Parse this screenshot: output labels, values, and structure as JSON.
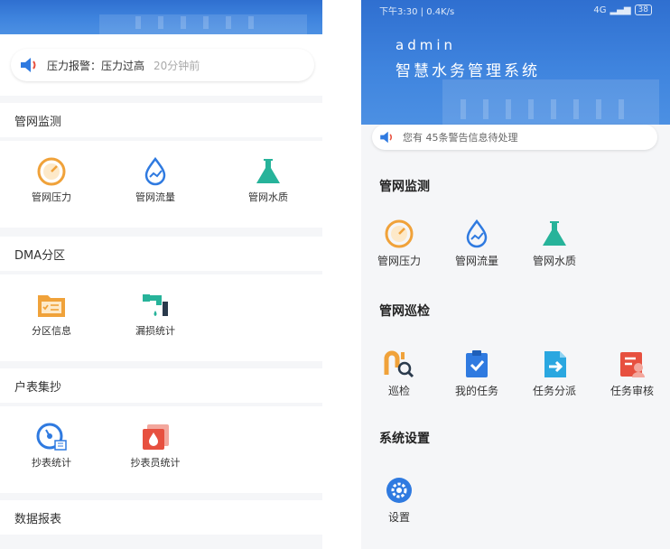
{
  "left": {
    "alert": {
      "text": "压力报警：压力过高",
      "time": "20分钟前"
    },
    "sections": [
      {
        "title": "管网监测",
        "items": [
          {
            "label": "管网压力",
            "icon": "gauge-icon"
          },
          {
            "label": "管网流量",
            "icon": "flow-drop-icon"
          },
          {
            "label": "管网水质",
            "icon": "flask-icon"
          }
        ]
      },
      {
        "title": "DMA分区",
        "items": [
          {
            "label": "分区信息",
            "icon": "folder-list-icon"
          },
          {
            "label": "漏损统计",
            "icon": "leak-pipe-icon"
          }
        ]
      },
      {
        "title": "户表集抄",
        "items": [
          {
            "label": "抄表统计",
            "icon": "meter-stats-icon"
          },
          {
            "label": "抄表员统计",
            "icon": "meter-reader-icon"
          }
        ]
      },
      {
        "title": "数据报表",
        "items": []
      }
    ]
  },
  "right": {
    "status": {
      "time": "下午3:30",
      "speed": "0.4K/s",
      "network": "4G",
      "battery": "38"
    },
    "username": "admin",
    "app_title": "智慧水务管理系统",
    "notice": {
      "text": "您有 45条警告信息待处理"
    },
    "sections": [
      {
        "title": "管网监测",
        "items": [
          {
            "label": "管网压力",
            "icon": "gauge-icon"
          },
          {
            "label": "管网流量",
            "icon": "flow-drop-icon"
          },
          {
            "label": "管网水质",
            "icon": "flask-icon"
          }
        ]
      },
      {
        "title": "管网巡检",
        "items": [
          {
            "label": "巡检",
            "icon": "patrol-icon"
          },
          {
            "label": "我的任务",
            "icon": "clipboard-check-icon"
          },
          {
            "label": "任务分派",
            "icon": "task-assign-icon"
          },
          {
            "label": "任务审核",
            "icon": "task-review-icon"
          }
        ]
      },
      {
        "title": "系统设置",
        "items": [
          {
            "label": "设置",
            "icon": "gear-icon"
          }
        ]
      }
    ]
  },
  "colors": {
    "banner": "#3f84de",
    "orange": "#f0a23a",
    "blue": "#2f7ae0",
    "teal": "#27b39a",
    "red": "#e7503f",
    "speaker": "#2f7ae0"
  }
}
